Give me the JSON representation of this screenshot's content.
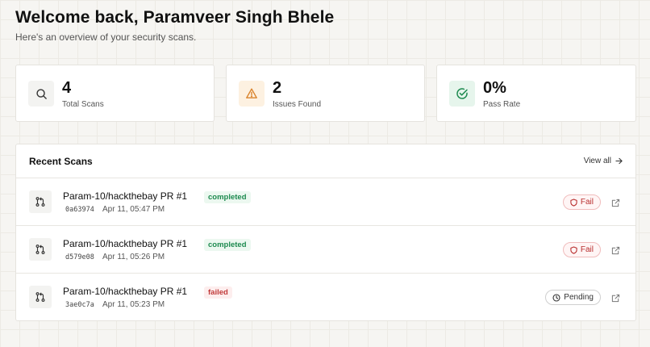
{
  "header": {
    "title": "Welcome back, Paramveer Singh Bhele",
    "subtitle": "Here's an overview of your security scans."
  },
  "stats": [
    {
      "icon": "search-icon",
      "value": "4",
      "label": "Total Scans",
      "color": "#333333",
      "bg": "#f3f3f1"
    },
    {
      "icon": "warning-icon",
      "value": "2",
      "label": "Issues Found",
      "color": "#d9822b",
      "bg": "#fdf1e1"
    },
    {
      "icon": "check-circle-icon",
      "value": "0%",
      "label": "Pass Rate",
      "color": "#1d8a4f",
      "bg": "#e6f5ec"
    }
  ],
  "recent_scans": {
    "title": "Recent Scans",
    "view_all_label": "View all",
    "rows": [
      {
        "name": "Param-10/hackthebay PR #1",
        "status": "completed",
        "hash": "0a63974",
        "time": "Apr 11, 05:47 PM",
        "result": "Fail"
      },
      {
        "name": "Param-10/hackthebay PR #1",
        "status": "completed",
        "hash": "d579e08",
        "time": "Apr 11, 05:26 PM",
        "result": "Fail"
      },
      {
        "name": "Param-10/hackthebay PR #1",
        "status": "failed",
        "hash": "3ae0c7a",
        "time": "Apr 11, 05:23 PM",
        "result": "Pending"
      }
    ]
  },
  "colors": {
    "completed": "#1d8a4f",
    "failed": "#c13a3a",
    "fail_badge": "#b82e2e"
  }
}
